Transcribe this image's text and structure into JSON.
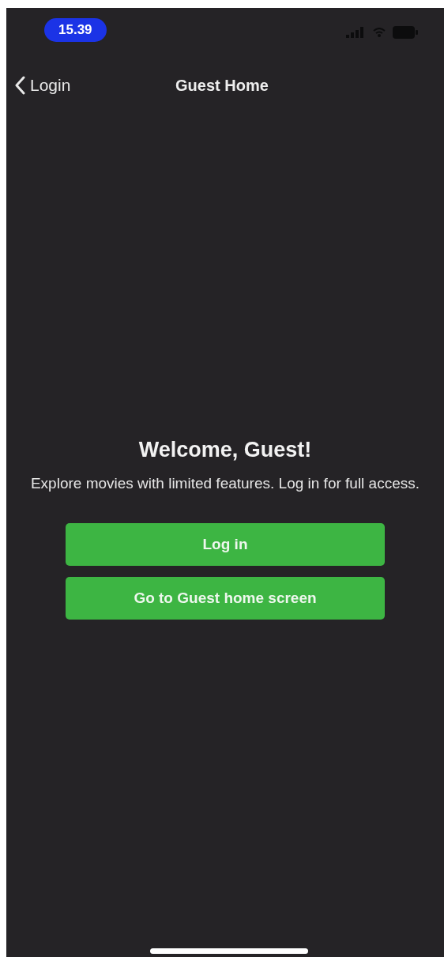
{
  "status_bar": {
    "time": "15.39"
  },
  "nav": {
    "back_label": "Login",
    "title": "Guest Home"
  },
  "welcome": {
    "heading": "Welcome, Guest!",
    "text": "Explore movies with limited features. Log in for full access."
  },
  "buttons": [
    {
      "label": "Log in"
    },
    {
      "label": "Go to Guest home screen"
    }
  ]
}
